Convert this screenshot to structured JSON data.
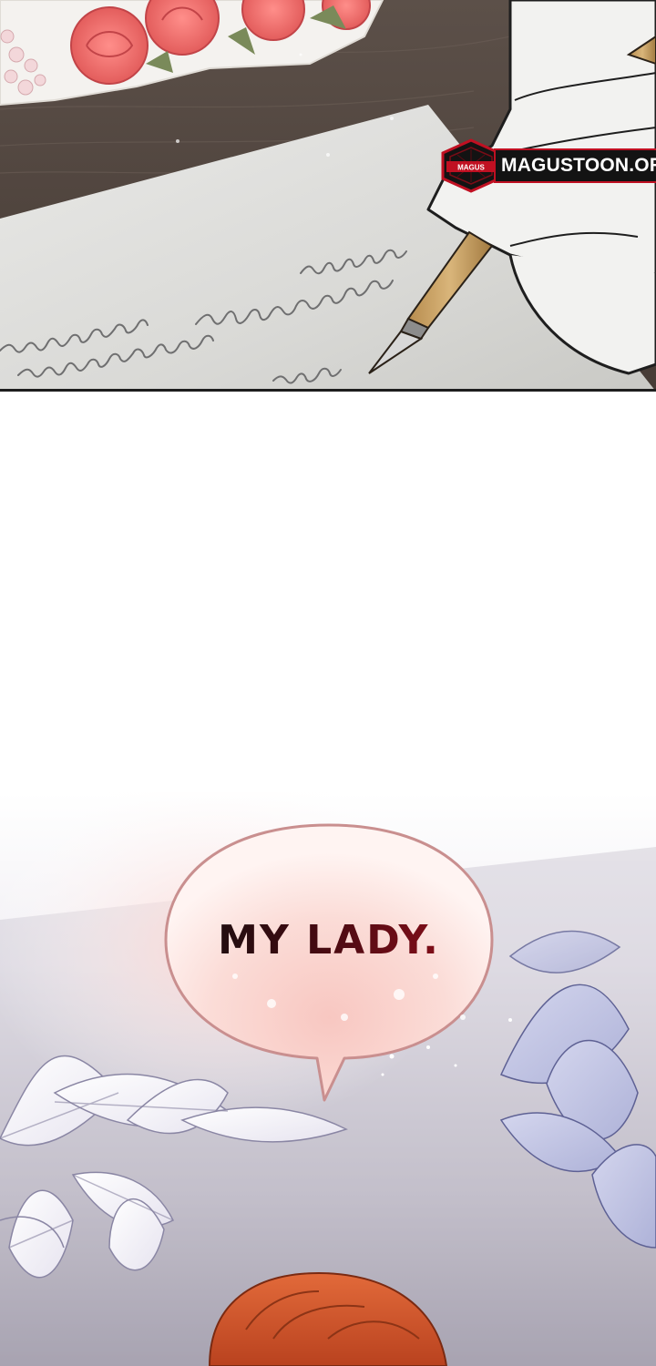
{
  "watermark": {
    "site_text": "MAGUSTOON.ORG",
    "icon": "magus-hexagon-logo",
    "colors": {
      "badge_bg": "#131313",
      "accent": "#c01022",
      "text": "#ffffff"
    }
  },
  "dialogue": {
    "bubble_text": "MY LADY."
  },
  "scene": {
    "top_panel": [
      "desk-with-roses",
      "letter-with-handwriting",
      "gloved-hand-with-pen"
    ],
    "bottom_panel": [
      "white-leaves",
      "red-haired-character"
    ]
  }
}
